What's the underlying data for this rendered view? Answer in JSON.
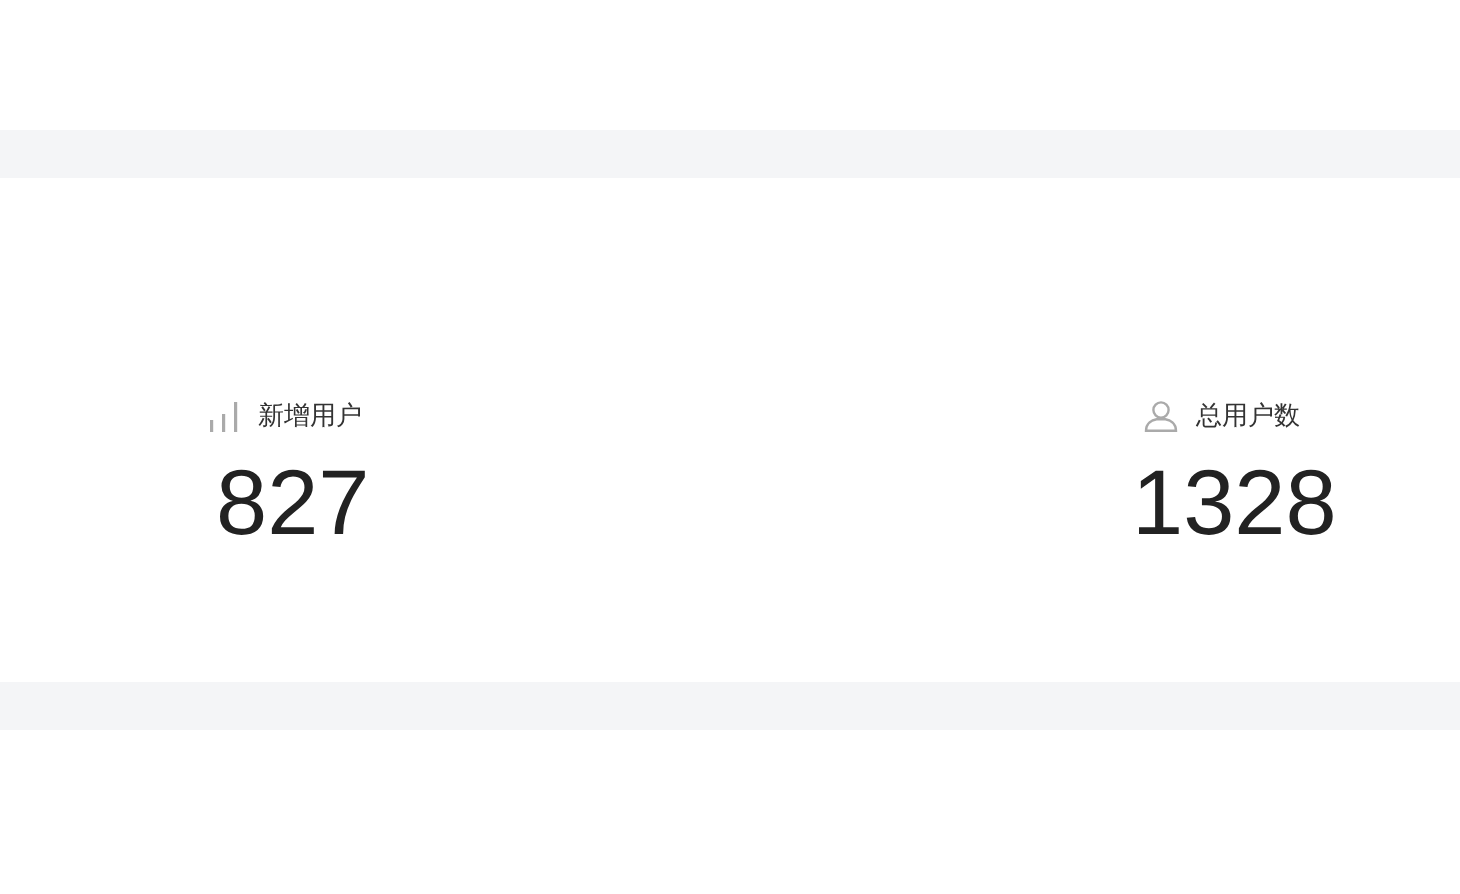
{
  "stats": [
    {
      "kind": "chart",
      "label": "新增用户",
      "value": "827"
    },
    {
      "kind": "user",
      "label": "总用户数",
      "value": "1328"
    }
  ]
}
